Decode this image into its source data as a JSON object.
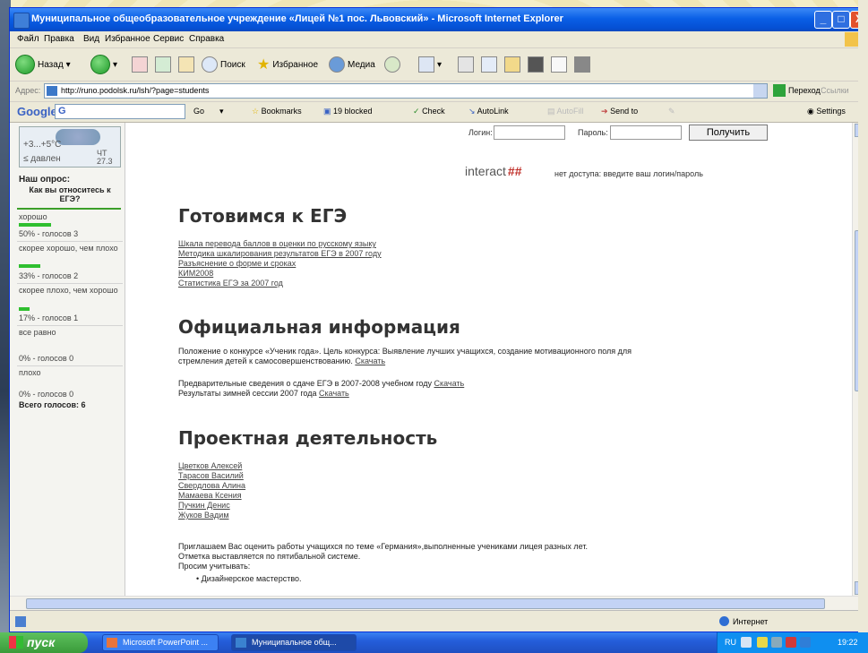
{
  "window": {
    "title": "Муниципальное общеобразовательное учреждение «Лицей №1 пос. Львовский» - Microsoft Internet Explorer",
    "min": "_",
    "max": "□",
    "close": "X"
  },
  "menu": [
    "Файл",
    "Правка",
    "Вид",
    "Избранное",
    "Сервис",
    "Справка"
  ],
  "toolbar": {
    "back": "Назад",
    "search": "Поиск",
    "favorites": "Избранное",
    "media": "Медиа"
  },
  "address": {
    "label": "Адрес:",
    "url": "http://runo.podolsk.ru/lsh/?page=students",
    "go": "Переход",
    "links": "Ссылки"
  },
  "googlebar": {
    "logo": "Google",
    "g": "G",
    "go": "Go",
    "bookmarks": "Bookmarks",
    "blocked": "19 blocked",
    "check": "Check",
    "autolink": "AutoLink",
    "autofill": "AutoFill",
    "sendto": "Send to",
    "settings": "Settings"
  },
  "weather": {
    "temp": "+3...+5°C",
    "pressure": "≤ давлен",
    "day": "ЧТ",
    "date": "27.3"
  },
  "poll": {
    "title": "Наш опрос:",
    "question": "Как вы относитесь к ЕГЭ?",
    "options": [
      {
        "label": "хорошо",
        "result": "50% - голосов 3",
        "pct": 50
      },
      {
        "label": "скорее хорошо, чем плохо",
        "result": "33% - голосов 2",
        "pct": 33
      },
      {
        "label": "скорее плохо, чем хорошо",
        "result": "17% - голосов 1",
        "pct": 17
      },
      {
        "label": "все равно",
        "result": "0% - голосов 0",
        "pct": 0
      },
      {
        "label": "плохо",
        "result": "0% - голосов 0",
        "pct": 0
      }
    ],
    "total": "Всего голосов: 6"
  },
  "login": {
    "login_label": "Логин:",
    "password_label": "Пароль:",
    "submit": "Получить",
    "brand": "interact",
    "brand_mark": "##",
    "message": "нет доступа: введите ваш логин/пароль"
  },
  "sections": {
    "ege_title": "Готовимся к ЕГЭ",
    "ege_links": [
      "Шкала перевода баллов в оценки по русскому языку",
      "Методика шкалирования результатов ЕГЭ в 2007 году",
      "Разъяснение о форме и сроках",
      "КИМ2008",
      "Статистика ЕГЭ за 2007 год"
    ],
    "official_title": "Официальная информация",
    "official_p1a": "Положение о конкурсе «Ученик года». Цель конкурса: Выявление лучших учащихся, создание мотивационного поля для",
    "official_p1b": "стремления детей к самосовершенствованию.",
    "download": "Скачать",
    "official_p2": "Предварительные сведения о сдаче ЕГЭ в 2007-2008 учебном году",
    "official_p3": "Результаты зимней сессии 2007 года",
    "project_title": "Проектная деятельность",
    "project_links": [
      "Цветков Алексей",
      "Тарасов Василий",
      "Свердлова Алина",
      "Мамаева Ксения",
      "Пучкин Денис",
      "Жуков Вадим"
    ],
    "invite_1": "Приглашаем Вас оценить работы учащихся по теме «Германия»,выполненные учениками лицея разных лет.",
    "invite_2": "Отметка выставляется по пятибальной системе.",
    "invite_3": "Просим учитывать:",
    "bullet_1": "Дизайнерское мастерство."
  },
  "status": {
    "zone": "Интернет"
  },
  "taskbar": {
    "start": "пуск",
    "tasks": [
      "Microsoft PowerPoint ...",
      "Муниципальное общ..."
    ],
    "lang": "RU",
    "time": "19:22"
  }
}
